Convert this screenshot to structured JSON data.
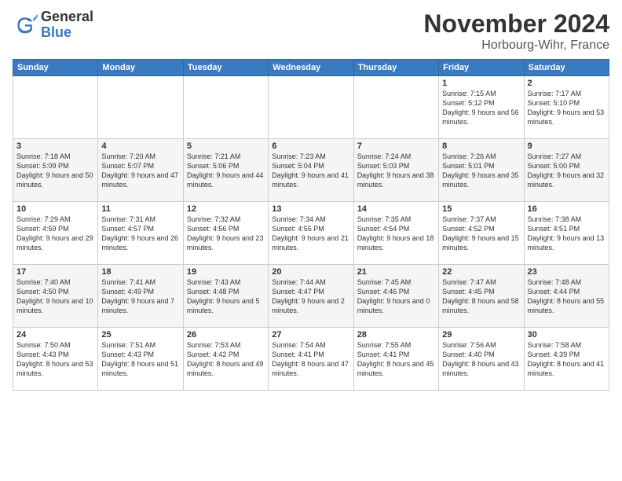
{
  "logo": {
    "general": "General",
    "blue": "Blue"
  },
  "title": "November 2024",
  "location": "Horbourg-Wihr, France",
  "weekdays": [
    "Sunday",
    "Monday",
    "Tuesday",
    "Wednesday",
    "Thursday",
    "Friday",
    "Saturday"
  ],
  "weeks": [
    [
      {
        "day": "",
        "info": ""
      },
      {
        "day": "",
        "info": ""
      },
      {
        "day": "",
        "info": ""
      },
      {
        "day": "",
        "info": ""
      },
      {
        "day": "",
        "info": ""
      },
      {
        "day": "1",
        "info": "Sunrise: 7:15 AM\nSunset: 5:12 PM\nDaylight: 9 hours and 56 minutes."
      },
      {
        "day": "2",
        "info": "Sunrise: 7:17 AM\nSunset: 5:10 PM\nDaylight: 9 hours and 53 minutes."
      }
    ],
    [
      {
        "day": "3",
        "info": "Sunrise: 7:18 AM\nSunset: 5:09 PM\nDaylight: 9 hours and 50 minutes."
      },
      {
        "day": "4",
        "info": "Sunrise: 7:20 AM\nSunset: 5:07 PM\nDaylight: 9 hours and 47 minutes."
      },
      {
        "day": "5",
        "info": "Sunrise: 7:21 AM\nSunset: 5:06 PM\nDaylight: 9 hours and 44 minutes."
      },
      {
        "day": "6",
        "info": "Sunrise: 7:23 AM\nSunset: 5:04 PM\nDaylight: 9 hours and 41 minutes."
      },
      {
        "day": "7",
        "info": "Sunrise: 7:24 AM\nSunset: 5:03 PM\nDaylight: 9 hours and 38 minutes."
      },
      {
        "day": "8",
        "info": "Sunrise: 7:26 AM\nSunset: 5:01 PM\nDaylight: 9 hours and 35 minutes."
      },
      {
        "day": "9",
        "info": "Sunrise: 7:27 AM\nSunset: 5:00 PM\nDaylight: 9 hours and 32 minutes."
      }
    ],
    [
      {
        "day": "10",
        "info": "Sunrise: 7:29 AM\nSunset: 4:59 PM\nDaylight: 9 hours and 29 minutes."
      },
      {
        "day": "11",
        "info": "Sunrise: 7:31 AM\nSunset: 4:57 PM\nDaylight: 9 hours and 26 minutes."
      },
      {
        "day": "12",
        "info": "Sunrise: 7:32 AM\nSunset: 4:56 PM\nDaylight: 9 hours and 23 minutes."
      },
      {
        "day": "13",
        "info": "Sunrise: 7:34 AM\nSunset: 4:55 PM\nDaylight: 9 hours and 21 minutes."
      },
      {
        "day": "14",
        "info": "Sunrise: 7:35 AM\nSunset: 4:54 PM\nDaylight: 9 hours and 18 minutes."
      },
      {
        "day": "15",
        "info": "Sunrise: 7:37 AM\nSunset: 4:52 PM\nDaylight: 9 hours and 15 minutes."
      },
      {
        "day": "16",
        "info": "Sunrise: 7:38 AM\nSunset: 4:51 PM\nDaylight: 9 hours and 13 minutes."
      }
    ],
    [
      {
        "day": "17",
        "info": "Sunrise: 7:40 AM\nSunset: 4:50 PM\nDaylight: 9 hours and 10 minutes."
      },
      {
        "day": "18",
        "info": "Sunrise: 7:41 AM\nSunset: 4:49 PM\nDaylight: 9 hours and 7 minutes."
      },
      {
        "day": "19",
        "info": "Sunrise: 7:43 AM\nSunset: 4:48 PM\nDaylight: 9 hours and 5 minutes."
      },
      {
        "day": "20",
        "info": "Sunrise: 7:44 AM\nSunset: 4:47 PM\nDaylight: 9 hours and 2 minutes."
      },
      {
        "day": "21",
        "info": "Sunrise: 7:45 AM\nSunset: 4:46 PM\nDaylight: 9 hours and 0 minutes."
      },
      {
        "day": "22",
        "info": "Sunrise: 7:47 AM\nSunset: 4:45 PM\nDaylight: 8 hours and 58 minutes."
      },
      {
        "day": "23",
        "info": "Sunrise: 7:48 AM\nSunset: 4:44 PM\nDaylight: 8 hours and 55 minutes."
      }
    ],
    [
      {
        "day": "24",
        "info": "Sunrise: 7:50 AM\nSunset: 4:43 PM\nDaylight: 8 hours and 53 minutes."
      },
      {
        "day": "25",
        "info": "Sunrise: 7:51 AM\nSunset: 4:43 PM\nDaylight: 8 hours and 51 minutes."
      },
      {
        "day": "26",
        "info": "Sunrise: 7:53 AM\nSunset: 4:42 PM\nDaylight: 8 hours and 49 minutes."
      },
      {
        "day": "27",
        "info": "Sunrise: 7:54 AM\nSunset: 4:41 PM\nDaylight: 8 hours and 47 minutes."
      },
      {
        "day": "28",
        "info": "Sunrise: 7:55 AM\nSunset: 4:41 PM\nDaylight: 8 hours and 45 minutes."
      },
      {
        "day": "29",
        "info": "Sunrise: 7:56 AM\nSunset: 4:40 PM\nDaylight: 8 hours and 43 minutes."
      },
      {
        "day": "30",
        "info": "Sunrise: 7:58 AM\nSunset: 4:39 PM\nDaylight: 8 hours and 41 minutes."
      }
    ]
  ]
}
